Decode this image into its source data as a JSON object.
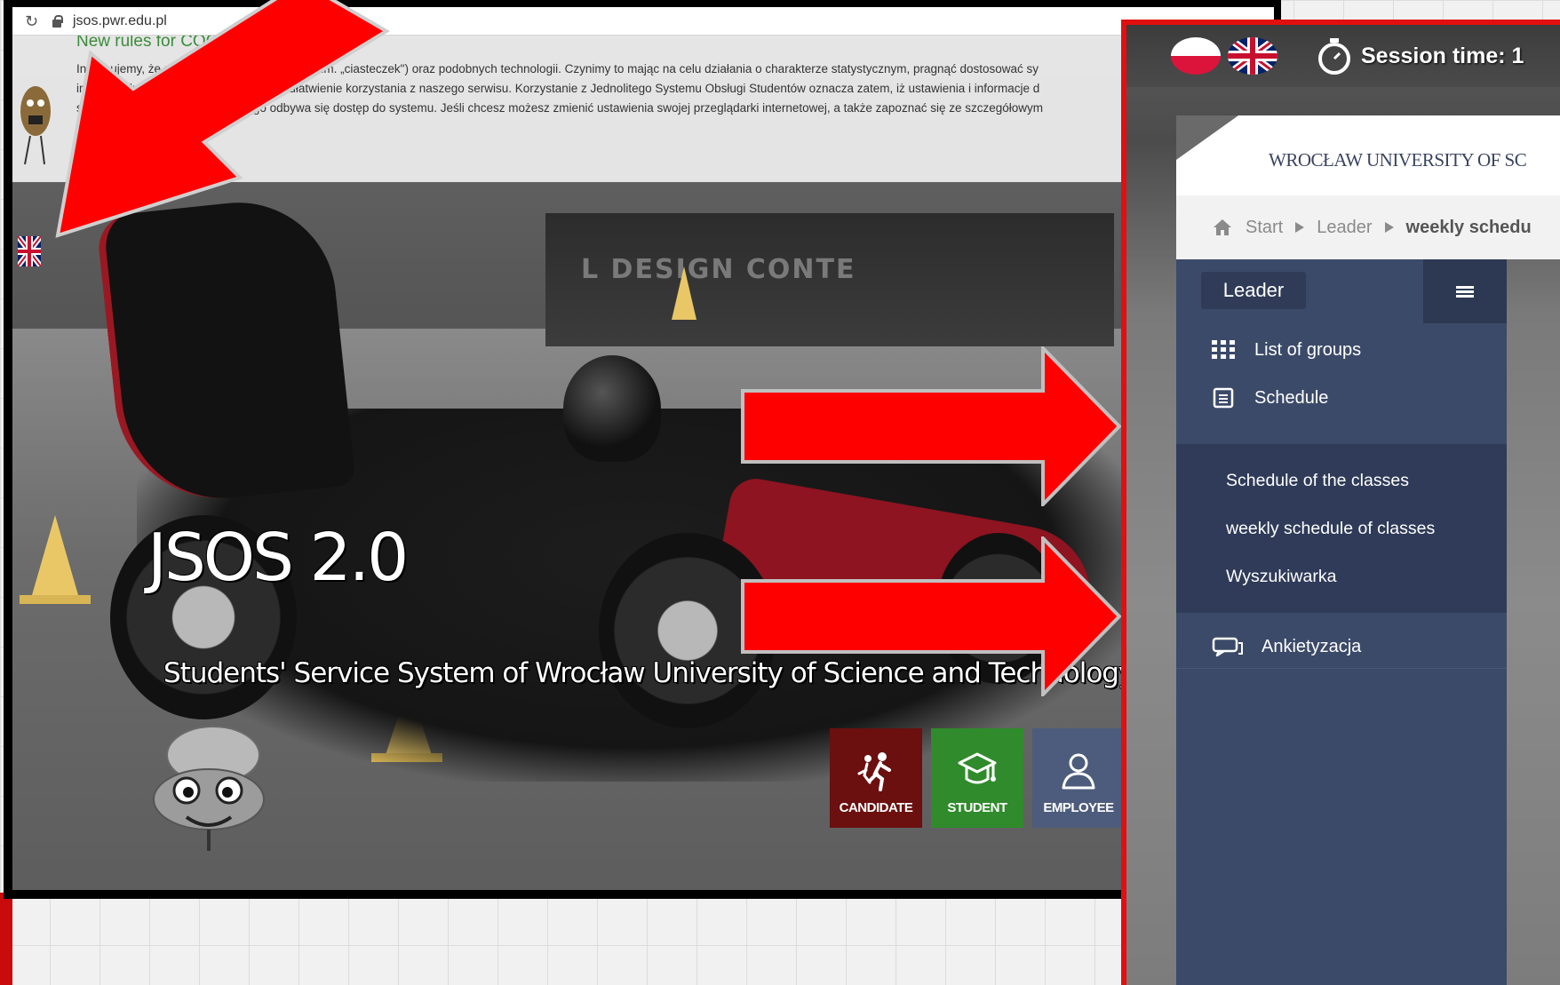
{
  "browser": {
    "url": "jsos.pwr.edu.pl"
  },
  "cookie_banner": {
    "title": "New rules for COOK",
    "text": "Informujemy, że na nas            w. plików „cookies\" (tłum. „ciasteczek\") oraz podobnych technologii. Czynimy to mając na celu działania o charakterze statystycznym, pragnąć dostosować sy\nindywidualnych pot             mając na względzie ułatwienie korzystania z naszego serwisu. Korzystanie z Jednolitego Systemu Obsługi Studentów oznacza zatem, iż ustawienia i informacje d\nserwisu zapis            urządzenia, z którego odbywa się dostęp do systemu. Jeśli chcesz możesz zmienić ustawienia swojej przeglądarki internetowej, a także zapoznać się ze szczegółowym\nw naszej"
  },
  "hero": {
    "title": "JSOS 2.0",
    "subtitle": "Students' Service System of Wrocław University of Science and Technology",
    "barrier_text": "L DESIGN CONTE"
  },
  "role_buttons": {
    "candidate": "CANDIDATE",
    "student": "STUDENT",
    "employee": "EMPLOYEE"
  },
  "zoom": {
    "session_label": "Session time: 1",
    "university_name": "WROCŁAW UNIVERSITY OF SC",
    "breadcrumb": {
      "start": "Start",
      "leader": "Leader",
      "current": "weekly schedu"
    },
    "sidebar": {
      "role": "Leader",
      "items": {
        "groups": "List of groups",
        "schedule": "Schedule",
        "survey": "Ankietyzacja"
      },
      "sub_items": {
        "classes": "Schedule of the classes",
        "weekly": "weekly schedule of classes",
        "search": "Wyszukiwarka"
      }
    }
  },
  "colors": {
    "arrow": "#ff0000",
    "candidate": "#6b0f0f",
    "student": "#2f8b2b",
    "employee": "#4d5c7c",
    "sidebar": "#3c4a69",
    "zoom_border": "#e10f0f"
  }
}
